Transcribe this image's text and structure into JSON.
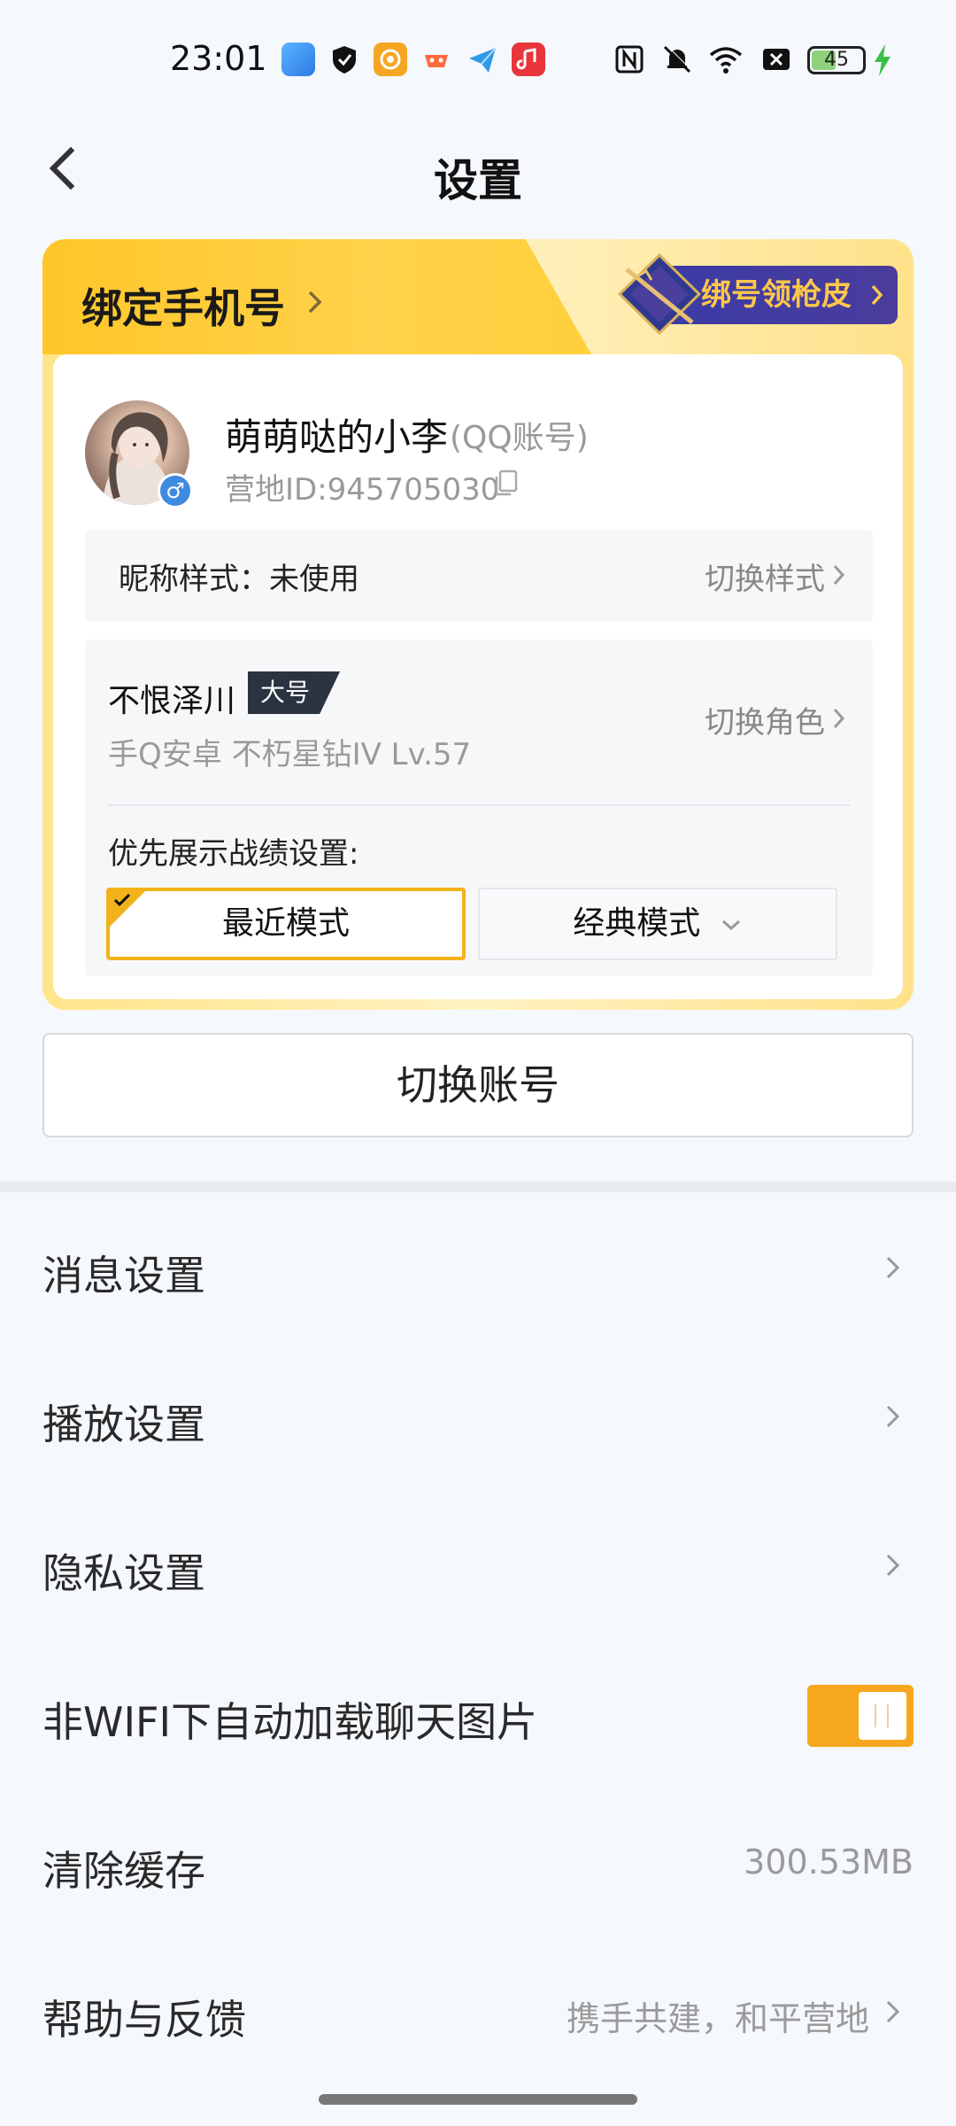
{
  "status_bar": {
    "time": "23:01",
    "battery": "45",
    "apps": [
      "gallery-icon",
      "shield-app-icon",
      "game-app-icon",
      "controller-app-icon",
      "send-app-icon",
      "music-app-icon"
    ],
    "right_icons": [
      "nfc-icon",
      "bell-mute-icon",
      "wifi-icon",
      "sim-off-icon"
    ]
  },
  "header": {
    "title": "设置"
  },
  "card": {
    "bind_phone": "绑定手机号",
    "bind_reward": "绑号领枪皮",
    "user": {
      "name": "萌萌哒的小李",
      "account_type": "(QQ账号)",
      "camp_id": "营地ID:945705030",
      "gender": "♂"
    },
    "nickname": {
      "label": "昵称样式：未使用",
      "action": "切换样式"
    },
    "role": {
      "name": "不恨泽川",
      "tag": "大号",
      "meta": "手Q安卓  不朽星钻IV  Lv.57",
      "action": "切换角色"
    },
    "priority_label": "优先展示战绩设置:",
    "modes": {
      "recent": "最近模式",
      "classic": "经典模式"
    }
  },
  "switch_account": "切换账号",
  "settings": [
    {
      "label": "消息设置"
    },
    {
      "label": "播放设置"
    },
    {
      "label": "隐私设置"
    },
    {
      "label": "非WIFI下自动加载聊天图片",
      "toggle_on": true
    },
    {
      "label": "清除缓存",
      "value": "300.53MB"
    },
    {
      "label": "帮助与反馈",
      "value": "携手共建，和平营地"
    }
  ],
  "colors": {
    "accent": "#f7a71e",
    "card_yellow": "#ffc629",
    "badge_purple": "#3b3ca6",
    "badge_text": "#ffc74a"
  }
}
